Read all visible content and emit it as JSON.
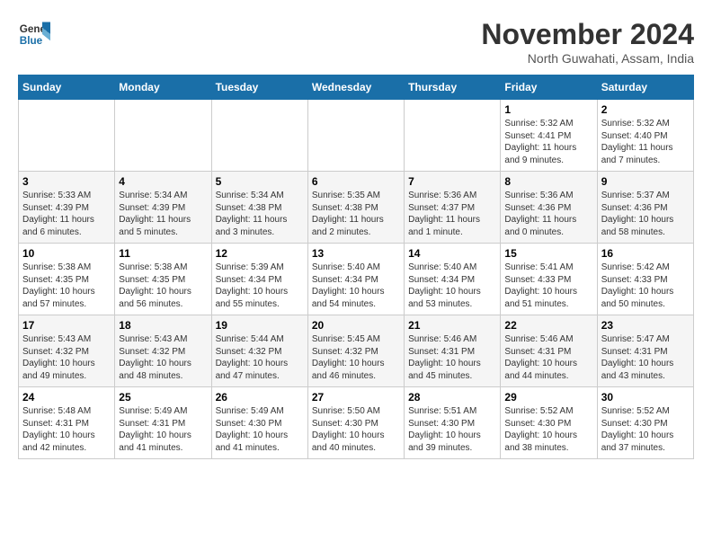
{
  "logo": {
    "line1": "General",
    "line2": "Blue"
  },
  "title": "November 2024",
  "subtitle": "North Guwahati, Assam, India",
  "weekdays": [
    "Sunday",
    "Monday",
    "Tuesday",
    "Wednesday",
    "Thursday",
    "Friday",
    "Saturday"
  ],
  "weeks": [
    [
      {
        "day": "",
        "content": ""
      },
      {
        "day": "",
        "content": ""
      },
      {
        "day": "",
        "content": ""
      },
      {
        "day": "",
        "content": ""
      },
      {
        "day": "",
        "content": ""
      },
      {
        "day": "1",
        "content": "Sunrise: 5:32 AM\nSunset: 4:41 PM\nDaylight: 11 hours\nand 9 minutes."
      },
      {
        "day": "2",
        "content": "Sunrise: 5:32 AM\nSunset: 4:40 PM\nDaylight: 11 hours\nand 7 minutes."
      }
    ],
    [
      {
        "day": "3",
        "content": "Sunrise: 5:33 AM\nSunset: 4:39 PM\nDaylight: 11 hours\nand 6 minutes."
      },
      {
        "day": "4",
        "content": "Sunrise: 5:34 AM\nSunset: 4:39 PM\nDaylight: 11 hours\nand 5 minutes."
      },
      {
        "day": "5",
        "content": "Sunrise: 5:34 AM\nSunset: 4:38 PM\nDaylight: 11 hours\nand 3 minutes."
      },
      {
        "day": "6",
        "content": "Sunrise: 5:35 AM\nSunset: 4:38 PM\nDaylight: 11 hours\nand 2 minutes."
      },
      {
        "day": "7",
        "content": "Sunrise: 5:36 AM\nSunset: 4:37 PM\nDaylight: 11 hours\nand 1 minute."
      },
      {
        "day": "8",
        "content": "Sunrise: 5:36 AM\nSunset: 4:36 PM\nDaylight: 11 hours\nand 0 minutes."
      },
      {
        "day": "9",
        "content": "Sunrise: 5:37 AM\nSunset: 4:36 PM\nDaylight: 10 hours\nand 58 minutes."
      }
    ],
    [
      {
        "day": "10",
        "content": "Sunrise: 5:38 AM\nSunset: 4:35 PM\nDaylight: 10 hours\nand 57 minutes."
      },
      {
        "day": "11",
        "content": "Sunrise: 5:38 AM\nSunset: 4:35 PM\nDaylight: 10 hours\nand 56 minutes."
      },
      {
        "day": "12",
        "content": "Sunrise: 5:39 AM\nSunset: 4:34 PM\nDaylight: 10 hours\nand 55 minutes."
      },
      {
        "day": "13",
        "content": "Sunrise: 5:40 AM\nSunset: 4:34 PM\nDaylight: 10 hours\nand 54 minutes."
      },
      {
        "day": "14",
        "content": "Sunrise: 5:40 AM\nSunset: 4:34 PM\nDaylight: 10 hours\nand 53 minutes."
      },
      {
        "day": "15",
        "content": "Sunrise: 5:41 AM\nSunset: 4:33 PM\nDaylight: 10 hours\nand 51 minutes."
      },
      {
        "day": "16",
        "content": "Sunrise: 5:42 AM\nSunset: 4:33 PM\nDaylight: 10 hours\nand 50 minutes."
      }
    ],
    [
      {
        "day": "17",
        "content": "Sunrise: 5:43 AM\nSunset: 4:32 PM\nDaylight: 10 hours\nand 49 minutes."
      },
      {
        "day": "18",
        "content": "Sunrise: 5:43 AM\nSunset: 4:32 PM\nDaylight: 10 hours\nand 48 minutes."
      },
      {
        "day": "19",
        "content": "Sunrise: 5:44 AM\nSunset: 4:32 PM\nDaylight: 10 hours\nand 47 minutes."
      },
      {
        "day": "20",
        "content": "Sunrise: 5:45 AM\nSunset: 4:32 PM\nDaylight: 10 hours\nand 46 minutes."
      },
      {
        "day": "21",
        "content": "Sunrise: 5:46 AM\nSunset: 4:31 PM\nDaylight: 10 hours\nand 45 minutes."
      },
      {
        "day": "22",
        "content": "Sunrise: 5:46 AM\nSunset: 4:31 PM\nDaylight: 10 hours\nand 44 minutes."
      },
      {
        "day": "23",
        "content": "Sunrise: 5:47 AM\nSunset: 4:31 PM\nDaylight: 10 hours\nand 43 minutes."
      }
    ],
    [
      {
        "day": "24",
        "content": "Sunrise: 5:48 AM\nSunset: 4:31 PM\nDaylight: 10 hours\nand 42 minutes."
      },
      {
        "day": "25",
        "content": "Sunrise: 5:49 AM\nSunset: 4:31 PM\nDaylight: 10 hours\nand 41 minutes."
      },
      {
        "day": "26",
        "content": "Sunrise: 5:49 AM\nSunset: 4:30 PM\nDaylight: 10 hours\nand 41 minutes."
      },
      {
        "day": "27",
        "content": "Sunrise: 5:50 AM\nSunset: 4:30 PM\nDaylight: 10 hours\nand 40 minutes."
      },
      {
        "day": "28",
        "content": "Sunrise: 5:51 AM\nSunset: 4:30 PM\nDaylight: 10 hours\nand 39 minutes."
      },
      {
        "day": "29",
        "content": "Sunrise: 5:52 AM\nSunset: 4:30 PM\nDaylight: 10 hours\nand 38 minutes."
      },
      {
        "day": "30",
        "content": "Sunrise: 5:52 AM\nSunset: 4:30 PM\nDaylight: 10 hours\nand 37 minutes."
      }
    ]
  ]
}
